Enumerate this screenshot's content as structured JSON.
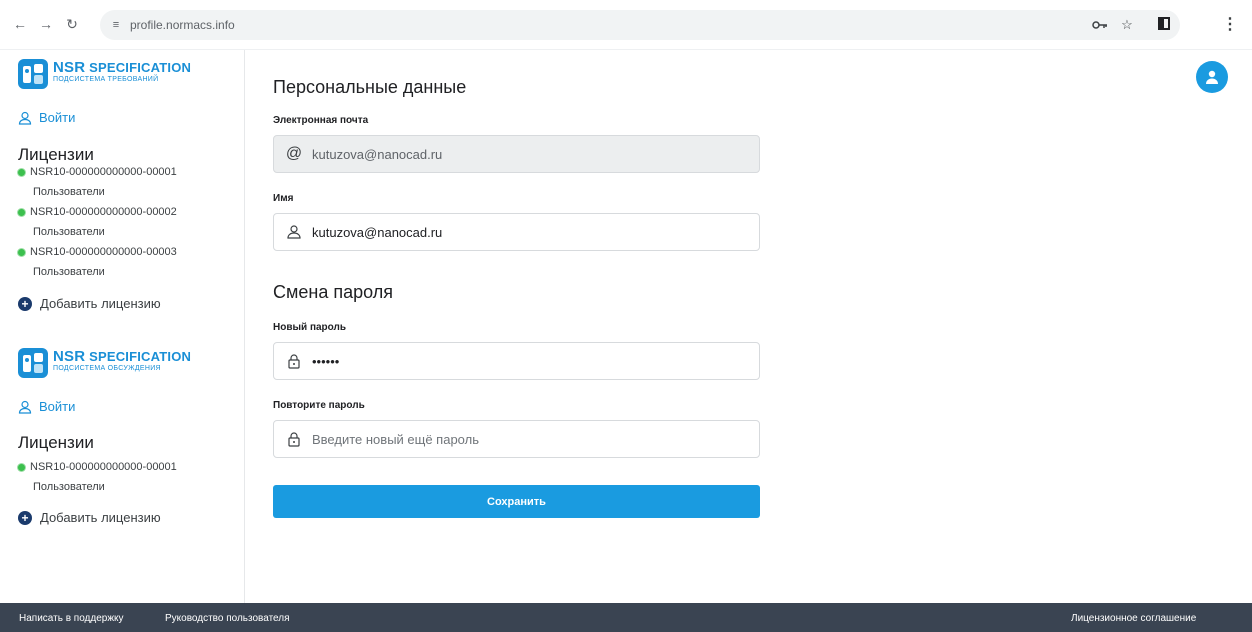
{
  "browser": {
    "url": "profile.normacs.info"
  },
  "sidebar": {
    "groups": [
      {
        "logo_title_main": "NSR",
        "logo_title_rest": "SPECIFICATION",
        "logo_subtitle": "ПОДСИСТЕМА ТРЕБОВАНИЙ",
        "login_label": "Войти",
        "licenses_title": "Лицензии",
        "licenses": [
          {
            "id": "NSR10-000000000000-00001",
            "users_label": "Пользователи"
          },
          {
            "id": "NSR10-000000000000-00002",
            "users_label": "Пользователи"
          },
          {
            "id": "NSR10-000000000000-00003",
            "users_label": "Пользователи"
          }
        ],
        "add_license_label": "Добавить лицензию"
      },
      {
        "logo_title_main": "NSR",
        "logo_title_rest": "SPECIFICATION",
        "logo_subtitle": "ПОДСИСТЕМА ОБСУЖДЕНИЯ",
        "login_label": "Войти",
        "licenses_title": "Лицензии",
        "licenses": [
          {
            "id": "NSR10-000000000000-00001",
            "users_label": "Пользователи"
          }
        ],
        "add_license_label": "Добавить лицензию"
      }
    ]
  },
  "main": {
    "personal_title": "Персональные данные",
    "email_label": "Электронная почта",
    "email_value": "kutuzova@nanocad.ru",
    "name_label": "Имя",
    "name_value": "kutuzova@nanocad.ru",
    "password_title": "Смена пароля",
    "new_password_label": "Новый пароль",
    "new_password_value": "••••••",
    "repeat_password_label": "Повторите пароль",
    "repeat_password_placeholder": "Введите новый ещё пароль",
    "save_label": "Сохранить"
  },
  "footer": {
    "support_link": "Написать в поддержку",
    "guide_link": "Руководство пользователя",
    "license_agreement_link": "Лицензионное соглашение"
  },
  "colors": {
    "accent": "#1a9be0",
    "footer_bg": "#3a4452",
    "license_active": "#3cc04e"
  }
}
